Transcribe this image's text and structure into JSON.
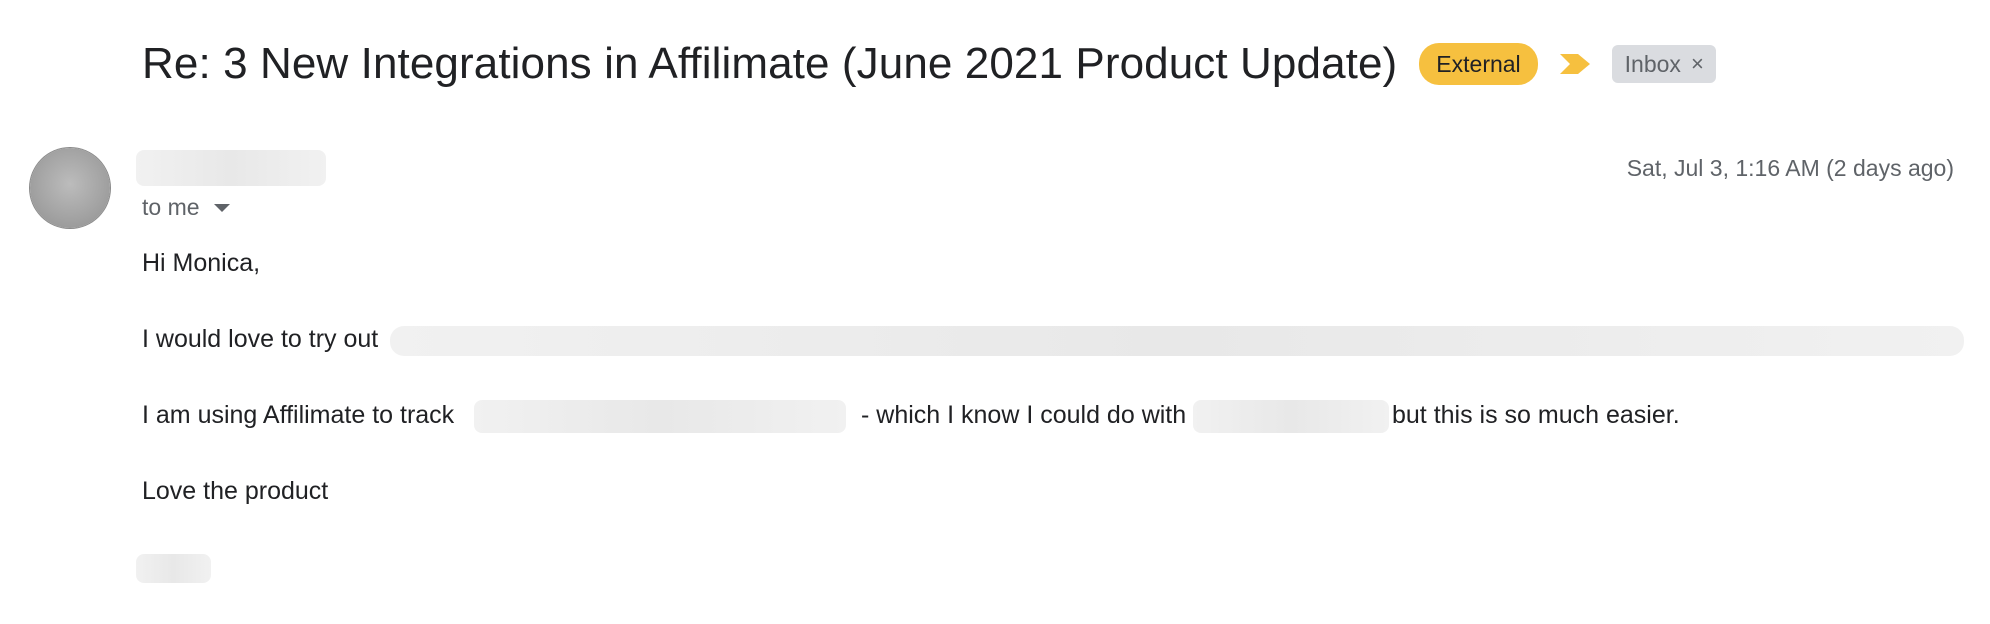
{
  "email": {
    "subject": "Re: 3 New Integrations in Affilimate (June 2021 Product Update)",
    "badges": {
      "external": "External",
      "inbox_label": "Inbox",
      "remove_label_symbol": "×"
    },
    "recipient_text": "to me",
    "date": "Sat, Jul 3, 1:16 AM (2 days ago)",
    "body": {
      "greeting": "Hi Monica,",
      "line_tryout": "I would love to try out",
      "line_track_prefix": "I am using Affilimate to track",
      "line_track_middle": "- which I know I could do with",
      "line_track_suffix": "but this is so much easier.",
      "closing": "Love the product"
    }
  },
  "colors": {
    "external_badge": "#f6c03f",
    "importance_marker": "#f6c03f",
    "inbox_label_bg": "#dadce0",
    "subject_text": "#202124",
    "secondary_text": "#5f6368"
  },
  "icons": {
    "importance": "importance-marker-icon",
    "remove_label": "close-icon",
    "expand_details": "caret-down-icon"
  }
}
